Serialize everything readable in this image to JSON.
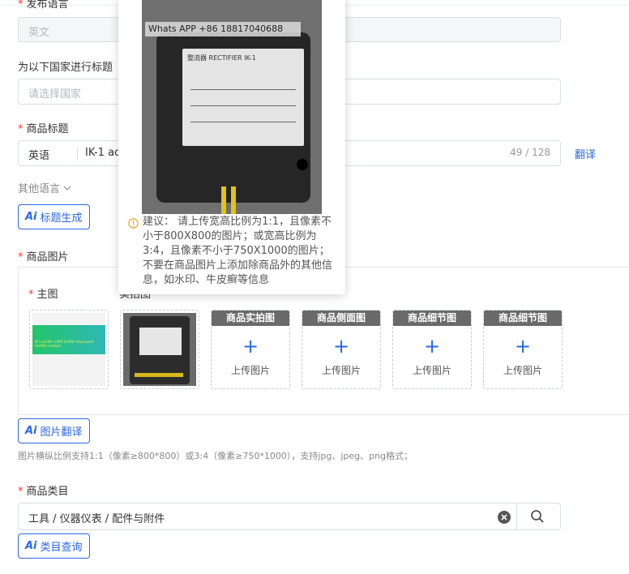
{
  "form": {
    "publish_language": {
      "label": "发布语言",
      "value": "英文"
    },
    "country": {
      "label": "为以下国家进行标题",
      "placeholder": "请选择国家"
    },
    "title": {
      "label": "商品标题",
      "lang": "英语",
      "value": "IK-1 ac200",
      "counter": "49 / 128",
      "translate": "翻译",
      "other_languages": "其他语言",
      "ai_button": "标题生成"
    },
    "images": {
      "label": "商品图片",
      "main_label": "主图",
      "side_label": "实拍图",
      "slots": [
        {
          "header": "商品实拍图",
          "action": "上传图片"
        },
        {
          "header": "商品侧面图",
          "action": "上传图片"
        },
        {
          "header": "商品细节图",
          "action": "上传图片"
        },
        {
          "header": "商品细节图",
          "action": "上传图片"
        }
      ],
      "thumb_text": "IK-1 ac200~240V dc90V relay board rectifier module",
      "ai_button": "图片翻译",
      "hint": "图片横纵比例支持1:1（像素≥800*800）或3:4（像素≥750*1000），支持jpg、jpeg、png格式；"
    },
    "category": {
      "label": "商品类目",
      "value": "工具 / 仪器仪表 / 配件与附件",
      "ai_button": "类目查询"
    }
  },
  "popover": {
    "watermark": "Whats APP +86 18817040688",
    "device_text": "整流器 RECTIFIER IK-1",
    "suggestion": "建议：  请上传宽高比例为1:1，且像素不小于800X800的图片；或宽高比例为3:4，且像素不小于750X1000的图片；不要在商品图片上添加除商品外的其他信息，如水印、牛皮癣等信息"
  },
  "colors": {
    "primary": "#2b67e6",
    "required": "#e23b3b",
    "warning": "#f0a020"
  }
}
